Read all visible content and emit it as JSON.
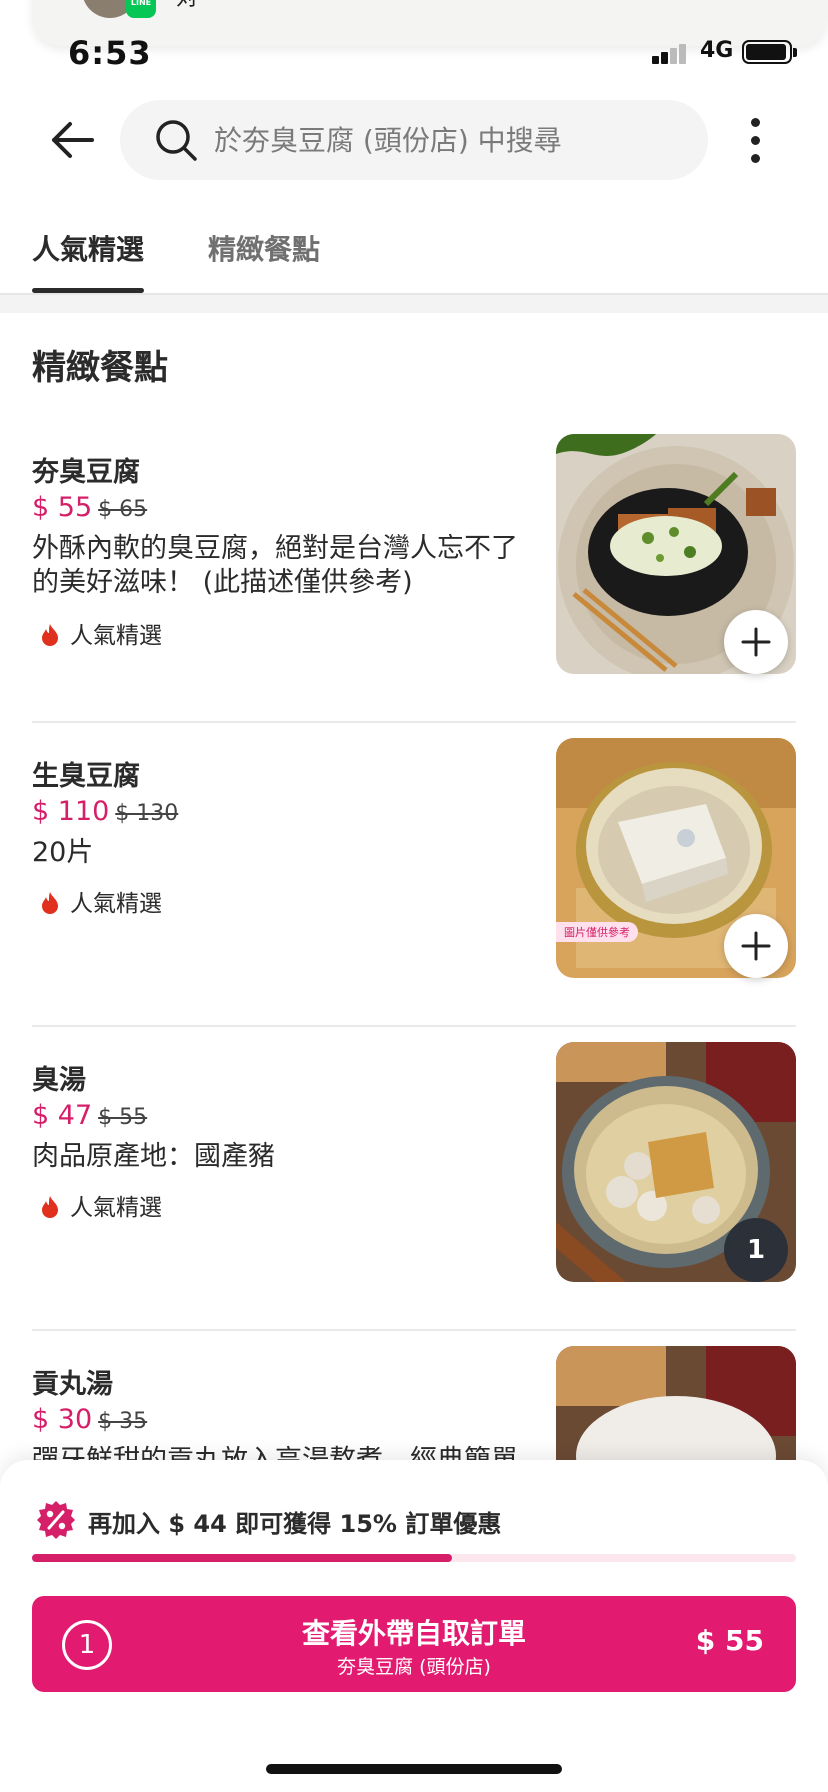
{
  "notification": {
    "app": "LINE",
    "text": "对"
  },
  "status_bar": {
    "time": "6:53",
    "network": "4G"
  },
  "search": {
    "placeholder": "於夯臭豆腐 (頭份店) 中搜尋"
  },
  "tabs": [
    {
      "label": "人氣精選",
      "active": true
    },
    {
      "label": "精緻餐點",
      "active": false
    }
  ],
  "section_title": "精緻餐點",
  "items": [
    {
      "name": "夯臭豆腐",
      "price": "$ 55",
      "original_price": "$ 65",
      "description": "外酥內軟的臭豆腐，絕對是台灣人忘不了的美好滋味！ (此描述僅供參考)",
      "tag": "人氣精選",
      "action": "add"
    },
    {
      "name": "生臭豆腐",
      "price": "$ 110",
      "original_price": "$ 130",
      "description": "20片",
      "tag": "人氣精選",
      "image_label": "圖片僅供參考",
      "action": "add"
    },
    {
      "name": "臭湯",
      "price": "$ 47",
      "original_price": "$ 55",
      "description": "肉品原產地：國產豬",
      "tag": "人氣精選",
      "quantity": "1"
    },
    {
      "name": "貢丸湯",
      "price": "$ 30",
      "original_price": "$ 35",
      "description": "彈牙鮮甜的貢丸放入高湯熬煮，經典簡單"
    }
  ],
  "cart": {
    "promo_text": "再加入 $ 44 即可獲得 15% 訂單優惠",
    "progress_fraction": 0.55,
    "count": "1",
    "button_title": "查看外帶自取訂單",
    "store_name": "夯臭豆腐 (頭份店)",
    "total": "$ 55"
  },
  "colors": {
    "brand": "#e21b70",
    "price": "#d61f69",
    "progress_track": "#fde7ef"
  }
}
